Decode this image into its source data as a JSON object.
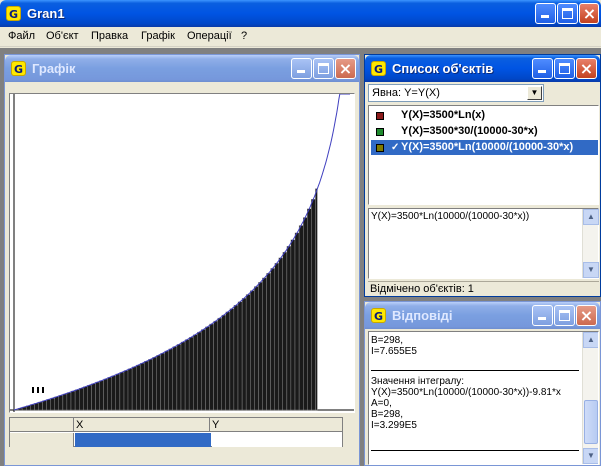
{
  "app": {
    "title": "Gran1",
    "icon": "gran-g-icon"
  },
  "menu": [
    {
      "label": "Файл"
    },
    {
      "label": "Об'єкт"
    },
    {
      "label": "Правка"
    },
    {
      "label": "Графік"
    },
    {
      "label": "Операції"
    },
    {
      "label": "?"
    }
  ],
  "graph_window": {
    "title": "Графік",
    "table": {
      "col_x": "X",
      "col_y": "Y"
    }
  },
  "objects_window": {
    "title": "Список об'єктів",
    "filter_selected": "Явна: Y=Y(X)",
    "items": [
      {
        "label": "Y(X)=3500*Ln(x)",
        "color": "#8b1a1a",
        "checked": false,
        "selected": false
      },
      {
        "label": "Y(X)=3500*30/(10000-30*x)",
        "color": "#1f8a2e",
        "checked": false,
        "selected": false
      },
      {
        "label": "Y(X)=3500*Ln(10000/(10000-30*x)",
        "color": "#7f7a00",
        "checked": true,
        "selected": true
      }
    ],
    "check_glyph": "✓",
    "formula_edit": "Y(X)=3500*Ln(10000/(10000-30*x))",
    "status": "Відмічено об'єктів: 1"
  },
  "answers_window": {
    "title": "Відповіді",
    "lines": [
      "B=298,",
      "I=7.655E5",
      "",
      "Значення інтегралу:",
      "Y(X)=3500*Ln(10000/(10000-30*x))-9.81*x",
      "A=0,",
      "B=298,",
      "I=3.299E5"
    ]
  },
  "colors": {
    "curve": "#3f3fbf",
    "bars": "#1a1a1a",
    "selection": "#316ac5"
  },
  "chart_data": {
    "type": "area",
    "function": "Y(X)=3500*Ln(10000/(10000-30*x))",
    "integration": {
      "a": 0,
      "b": 298
    },
    "xlim": [
      0,
      330
    ],
    "ylim": [
      0,
      11000
    ],
    "grid": false,
    "series": [
      {
        "name": "Y(X)=3500*Ln(10000/(10000-30*x)",
        "style": "curve"
      }
    ]
  }
}
